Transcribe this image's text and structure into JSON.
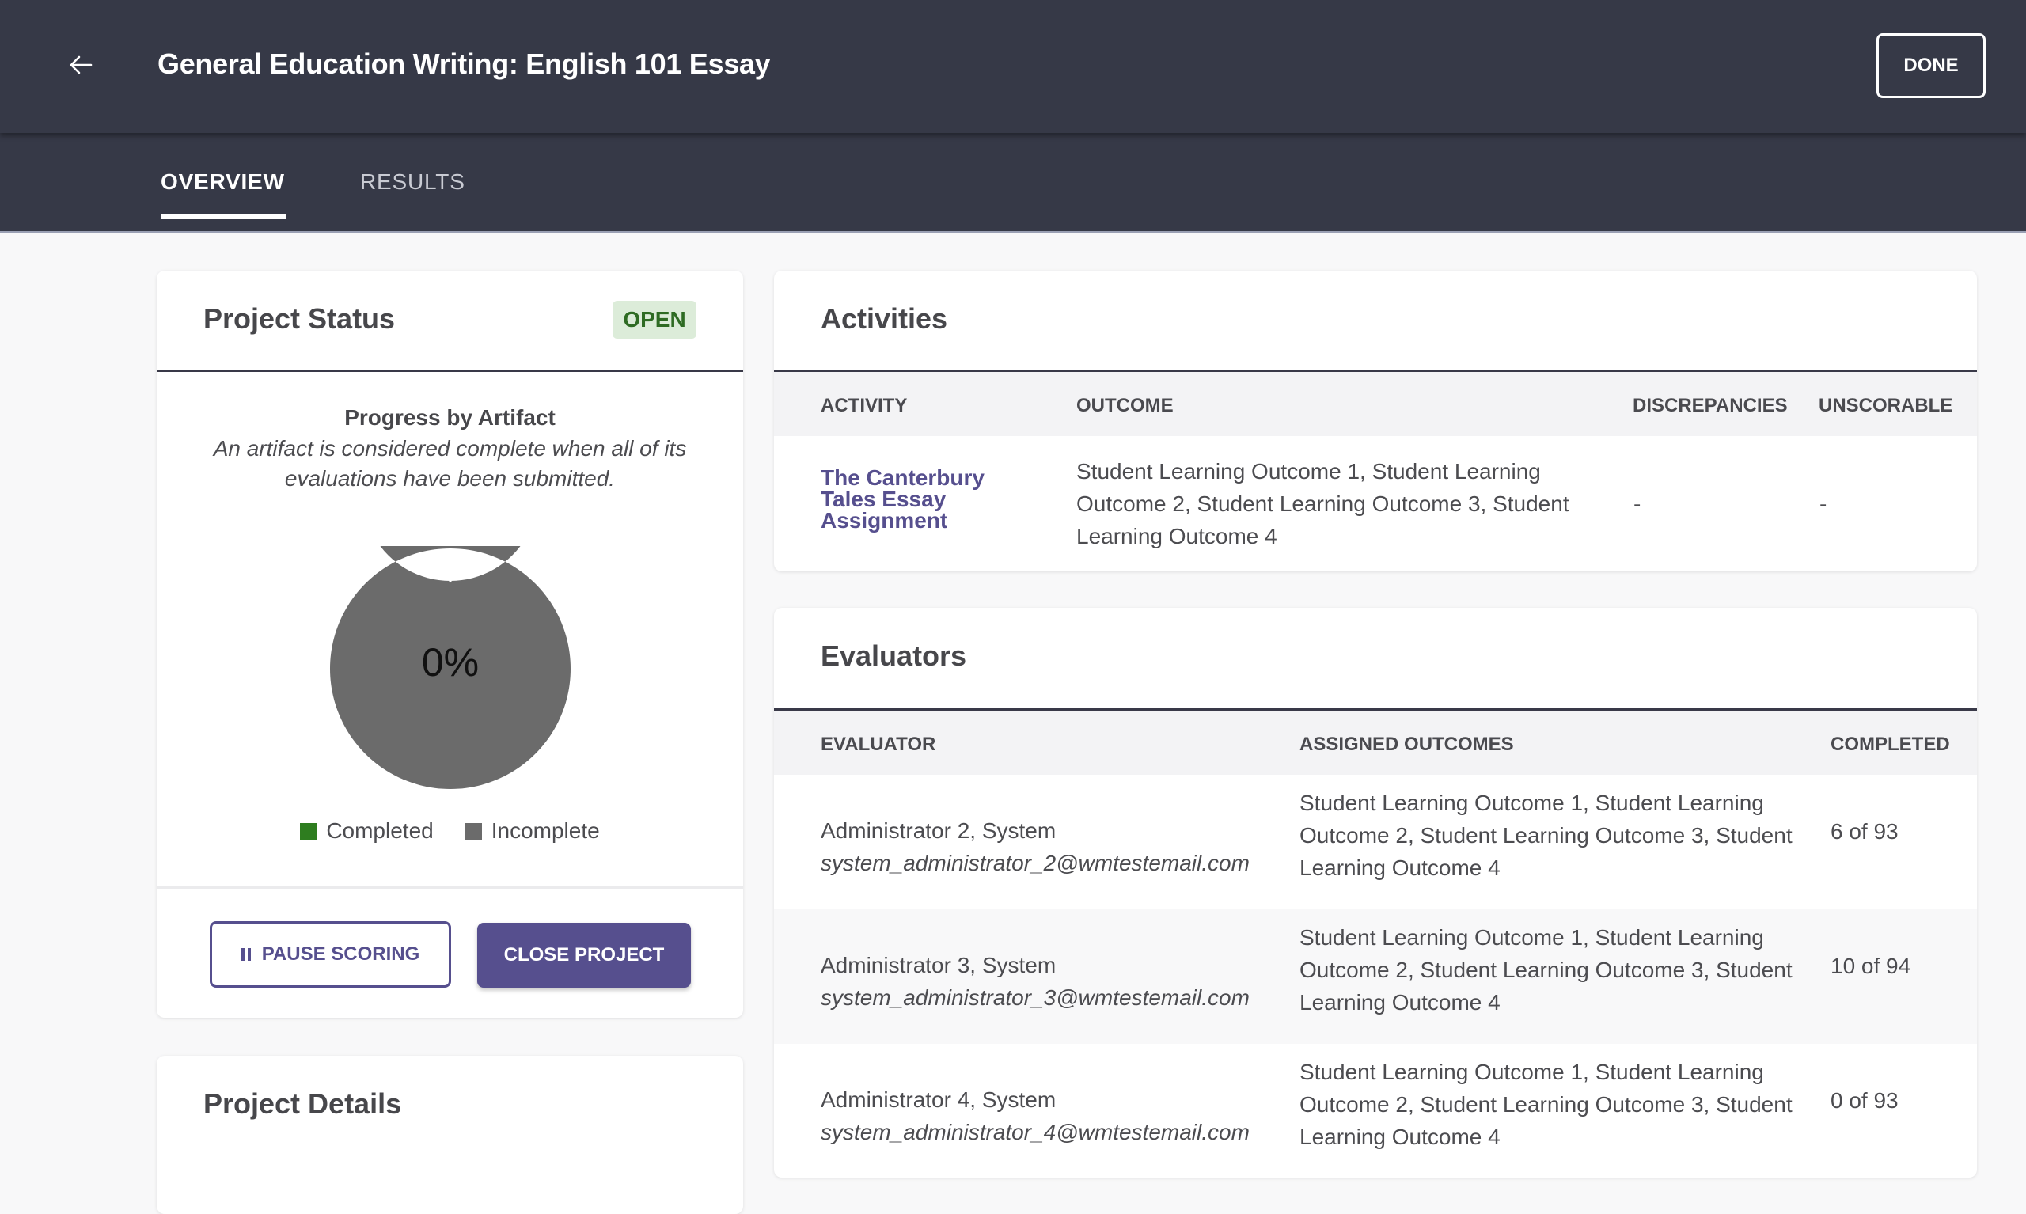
{
  "header": {
    "back_icon": "arrow-left-icon",
    "title": "General Education Writing: English 101 Essay",
    "done_label": "DONE"
  },
  "tabs": [
    {
      "label": "OVERVIEW",
      "active": true
    },
    {
      "label": "RESULTS",
      "active": false
    }
  ],
  "project_status": {
    "title": "Project Status",
    "badge": "OPEN",
    "progress_heading": "Progress by Artifact",
    "progress_note": "An artifact is considered complete when all of its evaluations have been submitted.",
    "percent_label": "0%",
    "pause_label": "PAUSE SCORING",
    "pause_icon": "pause-icon",
    "close_label": "CLOSE PROJECT"
  },
  "chart_data": {
    "type": "pie",
    "variant": "donut",
    "title": "Progress by Artifact",
    "center_label": "0%",
    "categories": [
      "Completed",
      "Incomplete"
    ],
    "values": [
      0,
      100
    ],
    "colors": [
      "#2e7d1f",
      "#6b6b6b"
    ],
    "legend": "bottom"
  },
  "project_details": {
    "title": "Project Details"
  },
  "activities": {
    "title": "Activities",
    "columns": [
      "ACTIVITY",
      "OUTCOME",
      "DISCREPANCIES",
      "UNSCORABLE"
    ],
    "rows": [
      {
        "activity": "The Canterbury Tales Essay Assignment",
        "outcome": "Student Learning Outcome 1, Student Learning Outcome 2, Student Learning Outcome 3, Student Learning Outcome 4",
        "discrepancies": "-",
        "unscorable": "-"
      }
    ]
  },
  "evaluators": {
    "title": "Evaluators",
    "columns": [
      "EVALUATOR",
      "ASSIGNED OUTCOMES",
      "COMPLETED"
    ],
    "rows": [
      {
        "name": "Administrator 2, System",
        "email": "system_administrator_2@wmtestemail.com",
        "outcomes": "Student Learning Outcome 1, Student Learning Outcome 2, Student Learning Outcome 3, Student Learning Outcome 4",
        "completed": "6 of 93"
      },
      {
        "name": "Administrator 3, System",
        "email": "system_administrator_3@wmtestemail.com",
        "outcomes": "Student Learning Outcome 1, Student Learning Outcome 2, Student Learning Outcome 3, Student Learning Outcome 4",
        "completed": "10 of 94"
      },
      {
        "name": "Administrator 4, System",
        "email": "system_administrator_4@wmtestemail.com",
        "outcomes": "Student Learning Outcome 1, Student Learning Outcome 2, Student Learning Outcome 3, Student Learning Outcome 4",
        "completed": "0 of 93"
      }
    ]
  },
  "colors": {
    "header_bg": "#363947",
    "accent": "#564f8e",
    "open_badge_bg": "#dcecd9",
    "open_badge_text": "#2e6b23"
  }
}
